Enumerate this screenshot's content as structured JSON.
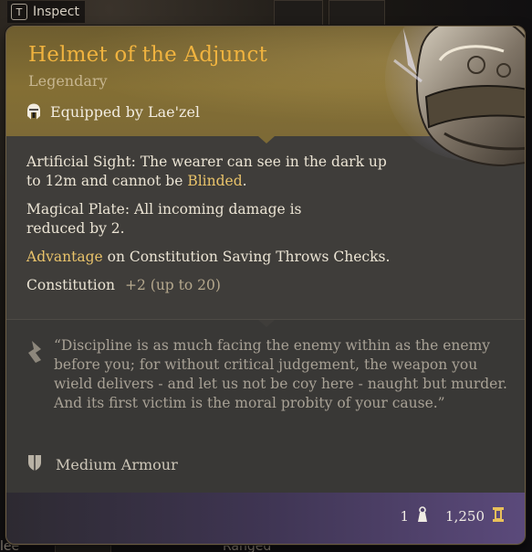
{
  "hint": {
    "key": "T",
    "label": "Inspect"
  },
  "item": {
    "name": "Helmet of the Adjunct",
    "rarity": "Legendary",
    "equipped_by": "Equipped by Lae'zel"
  },
  "properties": {
    "artificial_sight_name": "Artificial Sight:",
    "artificial_sight_text_1": "The wearer can see in the dark up to 12m and cannot be",
    "artificial_sight_highlight": "Blinded",
    "artificial_sight_end": ".",
    "magical_plate_name": "Magical Plate:",
    "magical_plate_text": "All incoming damage is reduced by 2.",
    "advantage_highlight": "Advantage",
    "advantage_text": "on Constitution Saving Throws Checks.",
    "ability": "Constitution",
    "ability_bonus": "+2",
    "ability_cap": "(up to 20)"
  },
  "flavor": {
    "quote": "“Discipline is as much facing the enemy within as the enemy before you; for without critical judgement, the weapon you wield delivers - and let us not be coy here - naught but murder. And its first victim is the moral probity of your cause.”"
  },
  "armour_type": "Medium Armour",
  "footer": {
    "weight": "1",
    "value": "1,250"
  },
  "background": {
    "left_fragment": "lee",
    "bottom_fragment": "Ranged"
  },
  "colors": {
    "name": "#f0b33f",
    "highlight": "#e9c36a",
    "header_bg": "#846f34",
    "footer_accent": "#5b4a7b"
  },
  "icons": [
    "key-cap",
    "helmet-icon",
    "quote-icon",
    "shield-icon",
    "weight-icon",
    "gold-icon"
  ]
}
